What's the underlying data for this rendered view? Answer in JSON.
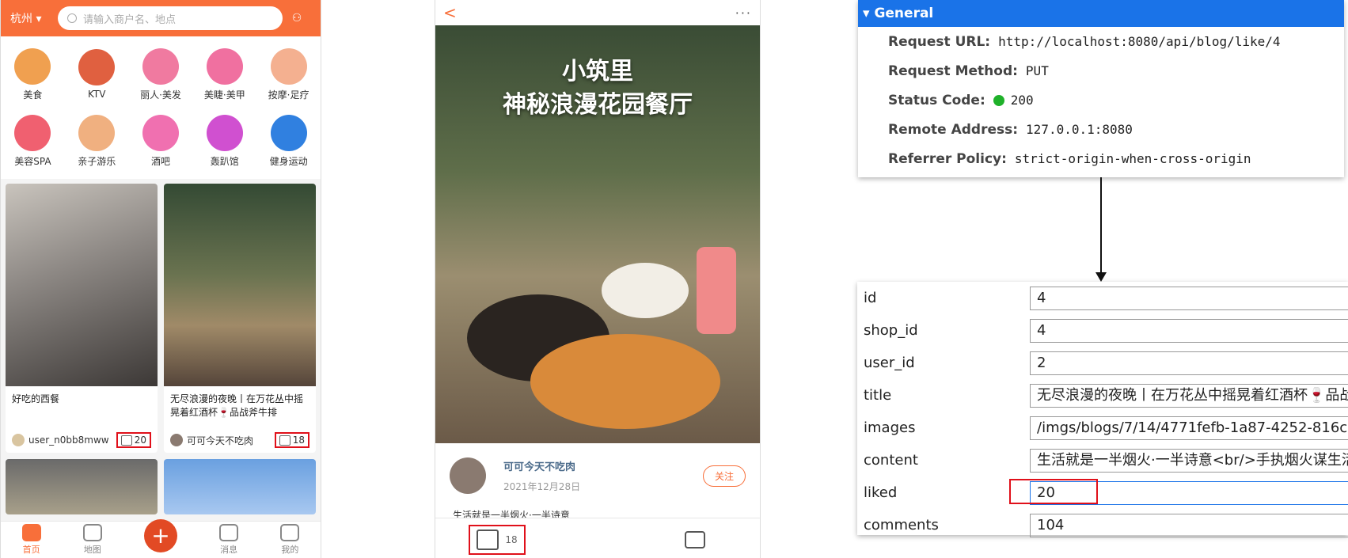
{
  "phone1": {
    "city": "杭州",
    "search_placeholder": "请输入商户名、地点",
    "categories": [
      "美食",
      "KTV",
      "丽人·美发",
      "美睫·美甲",
      "按摩·足疗",
      "美容SPA",
      "亲子游乐",
      "酒吧",
      "轰趴馆",
      "健身运动"
    ],
    "cards": [
      {
        "title": "好吃的西餐",
        "user": "user_n0bb8mww",
        "likes": "20"
      },
      {
        "title": "无尽浪漫的夜晚丨在万花丛中摇晃着红酒杯🍷品战斧牛排",
        "user": "可可今天不吃肉",
        "likes": "18"
      }
    ],
    "tabs": [
      {
        "label": "首页",
        "active": true
      },
      {
        "label": "地图",
        "active": false
      },
      {
        "label": "",
        "active": false
      },
      {
        "label": "消息",
        "active": false
      },
      {
        "label": "我的",
        "active": false
      }
    ],
    "fab": "+",
    "card1_image_title": "小筑里\n神秘浪漫花园餐厅"
  },
  "phone2": {
    "back": "<",
    "more": "···",
    "hero_title_line1": "小筑里",
    "hero_title_line2": "神秘浪漫花园餐厅",
    "author_name": "可可今天不吃肉",
    "date": "2021年12月28日",
    "follow": "关注",
    "content": "生活就是一半烟火·一半诗意",
    "likes": "18"
  },
  "devtools": {
    "section": "General",
    "rows": [
      {
        "key": "Request URL:",
        "value": "http://localhost:8080/api/blog/like/4"
      },
      {
        "key": "Request Method:",
        "value": "PUT"
      },
      {
        "key": "Status Code:",
        "value": "200"
      },
      {
        "key": "Remote Address:",
        "value": "127.0.0.1:8080"
      },
      {
        "key": "Referrer Policy:",
        "value": "strict-origin-when-cross-origin"
      }
    ]
  },
  "db": {
    "rows": [
      {
        "field": "id",
        "value": "4"
      },
      {
        "field": "shop_id",
        "value": "4"
      },
      {
        "field": "user_id",
        "value": "2"
      },
      {
        "field": "title",
        "value": "无尽浪漫的夜晚丨在万花丛中摇晃着红酒杯🍷品战"
      },
      {
        "field": "images",
        "value": "/imgs/blogs/7/14/4771fefb-1a87-4252-816c-"
      },
      {
        "field": "content",
        "value": "生活就是一半烟火·一半诗意<br/>手执烟火谋生活"
      },
      {
        "field": "liked",
        "value": "20"
      },
      {
        "field": "comments",
        "value": "104"
      }
    ]
  },
  "colors": {
    "accent": "#f86f3a",
    "highlight": "#e0101a",
    "devtools_blue": "#1a73e8",
    "status_green": "#1fb12a"
  }
}
